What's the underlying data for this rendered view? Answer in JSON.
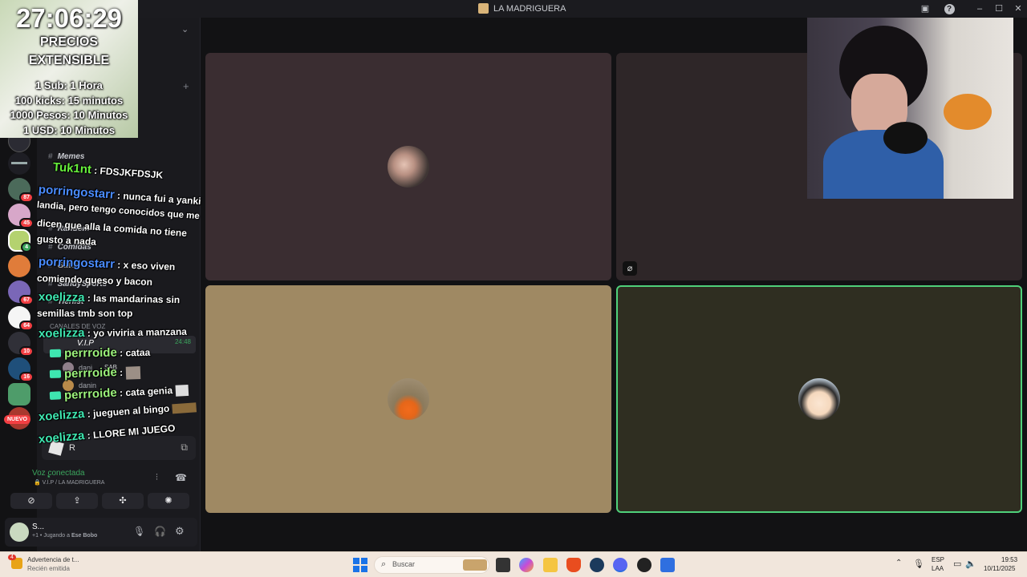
{
  "window": {
    "title": "LA MADRIGUERA",
    "icons": [
      "inbox-icon",
      "help-icon",
      "minimize-icon",
      "maximize-icon",
      "close-icon"
    ]
  },
  "overlay": {
    "timer": "27:06:29",
    "prices_title_1": "PRECIOS",
    "prices_title_2": "EXTENSIBLE",
    "prices": [
      "1 Sub: 1 Hora",
      "100 kicks: 15 minutos",
      "1000 Pesos: 10 Minutos",
      "1 USD: 10 Minutos"
    ]
  },
  "chat": [
    {
      "user": "Tuk1nt",
      "text": " : FDSJKFDSJK",
      "color": "#67f03c"
    },
    {
      "user": "porringostarr",
      "text": " : nunca fui a yanki",
      "color": "#4a8cff"
    },
    {
      "user": "",
      "text": "landia, pero tengo conocidos que me",
      "color": "#ffffff"
    },
    {
      "user": "",
      "text": "dicen que alla la comida no tiene",
      "color": "#ffffff"
    },
    {
      "user": "",
      "text": "gusto a nada",
      "color": "#ffffff"
    },
    {
      "user": "porringostarr",
      "text": " : x eso viven",
      "color": "#4a8cff"
    },
    {
      "user": "",
      "text": "comiendo queso y bacon",
      "color": "#ffffff"
    },
    {
      "user": "xoelizza",
      "text": " : las mandarinas sin",
      "color": "#3ee6b0"
    },
    {
      "user": "",
      "text": "semillas tmb son top",
      "color": "#ffffff"
    },
    {
      "user": "xoelizza",
      "text": " : yo viviria a manzana",
      "color": "#3ee6b0"
    },
    {
      "user": "perrroide",
      "text": " : cataa",
      "color": "#9cf27c"
    },
    {
      "user": "perrroide",
      "text": " :",
      "color": "#9cf27c"
    },
    {
      "user": "perrroide",
      "text": " : cata genia",
      "color": "#9cf27c"
    },
    {
      "user": "xoelizza",
      "text": " : jueguen al bingo",
      "color": "#3ee6b0"
    },
    {
      "user": "xoelizza",
      "text": " : LLORE MI JUEGO",
      "color": "#3ee6b0"
    }
  ],
  "sidebar": {
    "channels": [
      {
        "icon": "#",
        "name": "Memes"
      },
      {
        "icon": "#",
        "name": "Random"
      },
      {
        "icon": "#",
        "name": "Comidas"
      },
      {
        "icon": "#",
        "name": "Gatos"
      },
      {
        "icon": "#",
        "name": "SandySports"
      },
      {
        "icon": "#",
        "name": "Tierlist"
      }
    ],
    "voice_category": "CANALES DE VOZ",
    "voice_channel": "V.I.P",
    "voice_time": "24:48",
    "voice_members": [
      "dani",
      "danin"
    ],
    "member_tag": "SAB"
  },
  "servers": {
    "badges": [
      "87",
      "45",
      "4",
      "67",
      "64",
      "10",
      "16"
    ],
    "new_label": "NUEVO"
  },
  "voice_panel": {
    "activity_label": "R",
    "status": "Voz conectada",
    "channel_path": "V.I.P / LA MADRIGUERA",
    "buttons": [
      "camera-off-icon",
      "screen-share-icon",
      "activities-icon",
      "soundboard-icon"
    ]
  },
  "user_panel": {
    "name": "S...",
    "activity_prefix": "+1 • Jugando a ",
    "activity_game": "Ese Bobo"
  },
  "taskbar": {
    "notification_title": "Advertencia de t...",
    "notification_sub": "Recién emitida",
    "notification_count": "4",
    "search_placeholder": "Buscar",
    "lang_1": "ESP",
    "lang_2": "LAA",
    "time": "19:53",
    "date": "10/11/2025"
  },
  "colors": {
    "tile_1": "#3a2d31",
    "tile_2": "#2e2628",
    "tile_3": "#9f8963",
    "tile_4": "#2f2e21",
    "active_border": "#4fd17a",
    "voice_green": "#3ba55d"
  }
}
